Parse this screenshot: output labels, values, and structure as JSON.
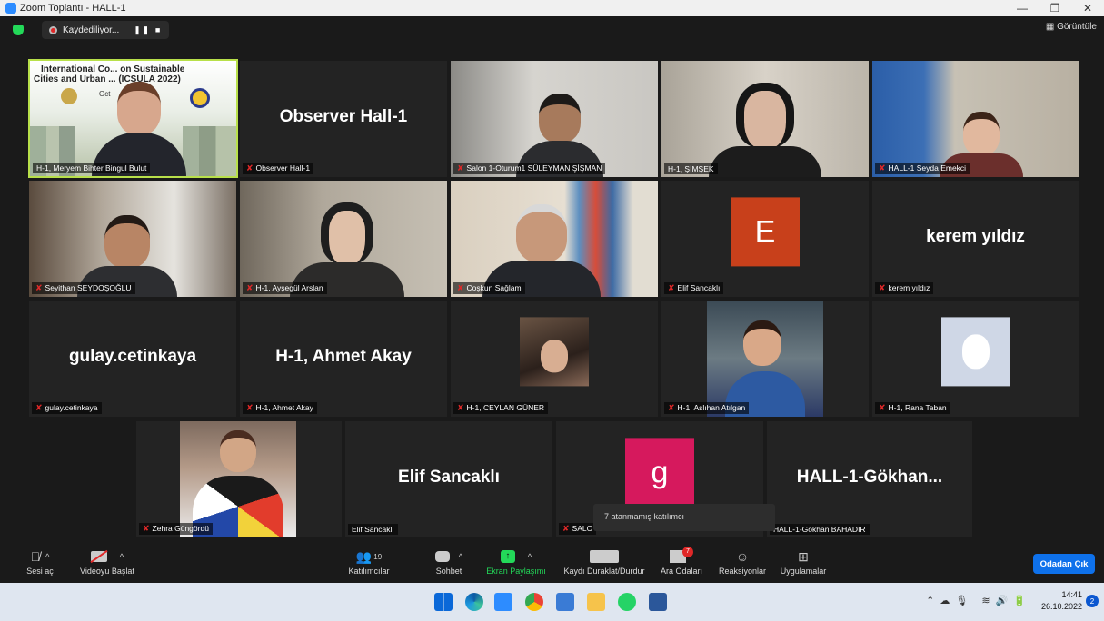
{
  "window": {
    "title": "Zoom Toplantı - HALL-1",
    "minimize": "—",
    "restore": "❐",
    "close": "✕"
  },
  "topbar": {
    "recording_label": "Kaydediliyor...",
    "rec_controls": "❚❚ ■",
    "view_label": "Görüntüle"
  },
  "tiles": [
    {
      "name": "H-1, Meryem Bihter Bingul Bulut",
      "slide_line1": "International Co... on Sustainable",
      "slide_line2": "Cities and Urban ... (ICSULA 2022)",
      "slide_date": "Oct"
    },
    {
      "name": "Observer Hall-1",
      "display": "Observer Hall-1"
    },
    {
      "name": "Salon 1-Oturum1 SÜLEYMAN ŞİŞMAN"
    },
    {
      "name": "H-1, ŞİMŞEK"
    },
    {
      "name": "HALL-1 Seyda Emekci"
    },
    {
      "name": "Seyithan SEYDOŞOĞLU"
    },
    {
      "name": "H-1, Ayşegül Arslan"
    },
    {
      "name": "Coşkun Sağlam"
    },
    {
      "name": "Elif Sancaklı",
      "initial": "E",
      "color": "#c8401b"
    },
    {
      "name": "kerem yıldız",
      "display": "kerem yıldız"
    },
    {
      "name": "gulay.cetinkaya",
      "display": "gulay.cetinkaya"
    },
    {
      "name": "H-1, Ahmet Akay",
      "display": "H-1, Ahmet Akay"
    },
    {
      "name": "H-1, CEYLAN GÜNER"
    },
    {
      "name": "H-1, Aslıhan Atılgan"
    },
    {
      "name": "H-1, Rana Taban"
    },
    {
      "name": "Zehra Güngördü"
    },
    {
      "name": "Elif Sancaklı",
      "display": "Elif Sancaklı"
    },
    {
      "name": "SALO",
      "initial": "g",
      "color": "#d6195d"
    },
    {
      "name": "HALL-1-Gökhan BAHADIR",
      "display": "HALL-1-Gökhan..."
    }
  ],
  "tooltip": "7 atanmamış katılımcı",
  "toolbar": {
    "mute": "Sesi aç",
    "video": "Videoyu Başlat",
    "participants": "Katılımcılar",
    "participants_count": "19",
    "chat": "Sohbet",
    "share": "Ekran Paylaşımı",
    "pause_rec": "Kaydı Duraklat/Durdur",
    "breakout": "Ara Odaları",
    "breakout_badge": "7",
    "reactions": "Reaksiyonlar",
    "apps": "Uygulamalar",
    "leave": "Odadan Çık"
  },
  "taskbar": {
    "time": "14:41",
    "date": "26.10.2022",
    "notifications": "2"
  }
}
